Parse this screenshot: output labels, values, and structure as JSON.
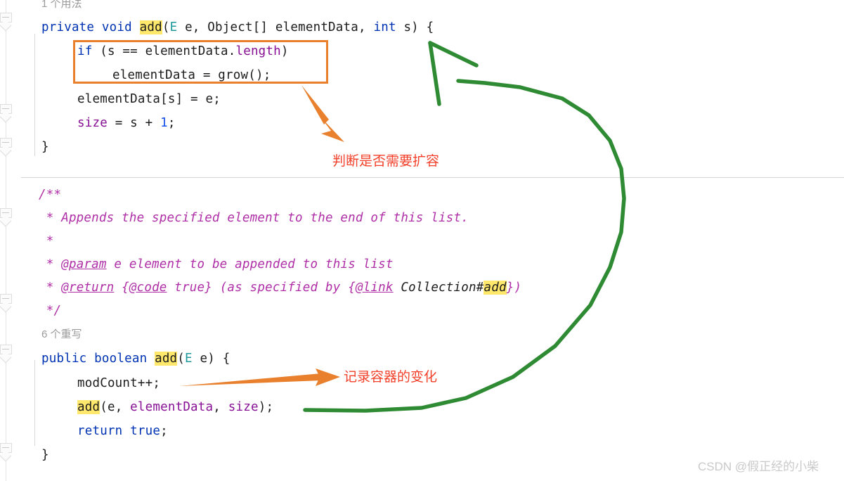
{
  "editor": {
    "top_usage_hint": "1 个用法",
    "override_hint": "6 个重写",
    "block1": {
      "signature": {
        "kw_private": "private",
        "sp1": " ",
        "kw_void": "void",
        "sp2": " ",
        "name_add": "add",
        "paren_open": "(",
        "type_E": "E",
        "arg_e": " e, ",
        "type_Object": "Object[]",
        "arg_elementData": " elementData, ",
        "kw_int": "int",
        "arg_s": " s) {"
      },
      "line_if": {
        "kw_if": "if",
        "cond_a": " (s == elementData.",
        "field_length": "length",
        "cond_b": ")"
      },
      "line_grow": "elementData = grow();",
      "line_assign": "elementData[s] = e;",
      "line_size": {
        "field_size": "size",
        "rest_a": " = s + ",
        "num_1": "1",
        "rest_b": ";"
      },
      "line_close": "}"
    },
    "javadoc": {
      "l1": "/**",
      "l2": " * Appends the specified element to the end of this list.",
      "l3": " *",
      "l4_star": " * ",
      "l4_tag": "@param",
      "l4_rest": " e element to be appended to this list",
      "l5_star": " * ",
      "l5_tag": "@return",
      "l5_mid": " {",
      "l5_tag2": "@code",
      "l5_mid2": " true} (as specified by {",
      "l5_tag3": "@link",
      "l5_mono": " Collection#",
      "l5_hl": "add",
      "l5_end": "})",
      "l6": " */"
    },
    "block2": {
      "signature": {
        "kw_public": "public",
        "sp1": " ",
        "kw_boolean": "boolean",
        "sp2": " ",
        "name_add": "add",
        "paren_open": "(",
        "type_E": "E",
        "arg_e": " e) {"
      },
      "line_modcount": "modCount++;",
      "line_addcall": {
        "hl_add": "add",
        "mid": "(e, ",
        "field_elementData": "elementData",
        "comma": ", ",
        "field_size": "size",
        "end": ");"
      },
      "line_return": {
        "kw_return": "return",
        "sp": " ",
        "kw_true": "true",
        "semi": ";"
      },
      "line_close": "}"
    }
  },
  "annotations": {
    "note_expand": "判断是否需要扩容",
    "note_modcount": "记录容器的变化",
    "box_label": "if-grow-highlight-box",
    "arrow_orange_1": "arrow-to-expand-note",
    "arrow_orange_2": "arrow-to-modcount-note",
    "arrow_green": "arrow-from-add-call-to-private-add"
  },
  "watermark": {
    "text": "CSDN @假正经的小柴"
  },
  "colors": {
    "keyword": "#0033b3",
    "field": "#871094",
    "type": "#20999d",
    "number": "#1750eb",
    "highlight": "#ffe86b",
    "javadoc": "#af2fa7",
    "annotation_orange": "#e8802e",
    "annotation_red": "#f2402a",
    "annotation_green": "#2f8b33",
    "watermark": "#c9c9c9"
  }
}
